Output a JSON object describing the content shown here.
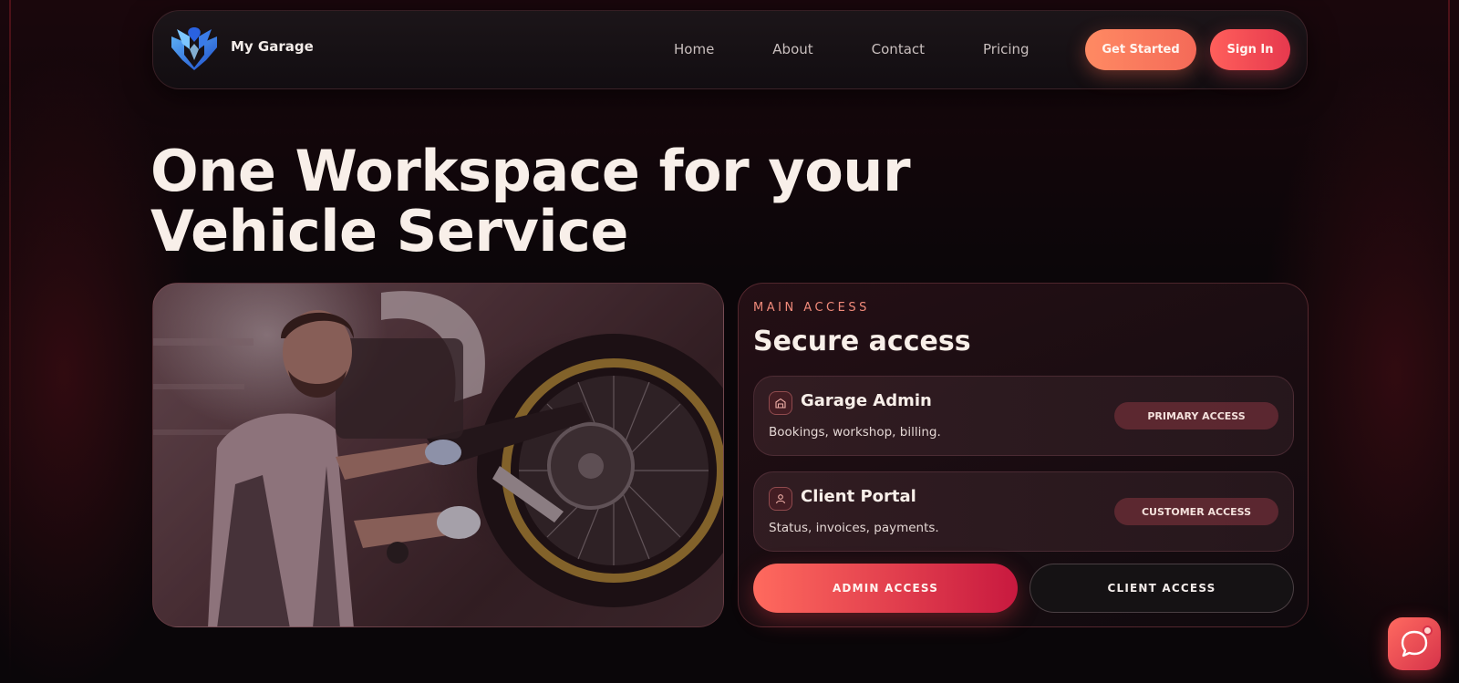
{
  "nav": {
    "brand": "My Garage",
    "links": [
      "Home",
      "About",
      "Contact",
      "Pricing"
    ],
    "get_started": "Get Started",
    "sign_in": "Sign In"
  },
  "hero": {
    "title_line1": "One Workspace for your",
    "title_line2": "Vehicle Service"
  },
  "access": {
    "kicker": "MAIN ACCESS",
    "title": "Secure access",
    "cards": [
      {
        "title": "Garage Admin",
        "desc": "Bookings, workshop, billing.",
        "badge": "PRIMARY ACCESS",
        "icon": "garage-icon"
      },
      {
        "title": "Client Portal",
        "desc": "Status, invoices, payments.",
        "badge": "CUSTOMER ACCESS",
        "icon": "user-icon"
      }
    ],
    "admin_button": "ADMIN ACCESS",
    "client_button": "CLIENT ACCESS"
  },
  "colors": {
    "accent": "#ff6a5e",
    "accent_dark": "#c8193f",
    "background": "#0b0609",
    "kicker": "#f08a7a"
  },
  "icons": {
    "logo": "shield-logo-icon",
    "chat": "chat-bubble-icon"
  }
}
